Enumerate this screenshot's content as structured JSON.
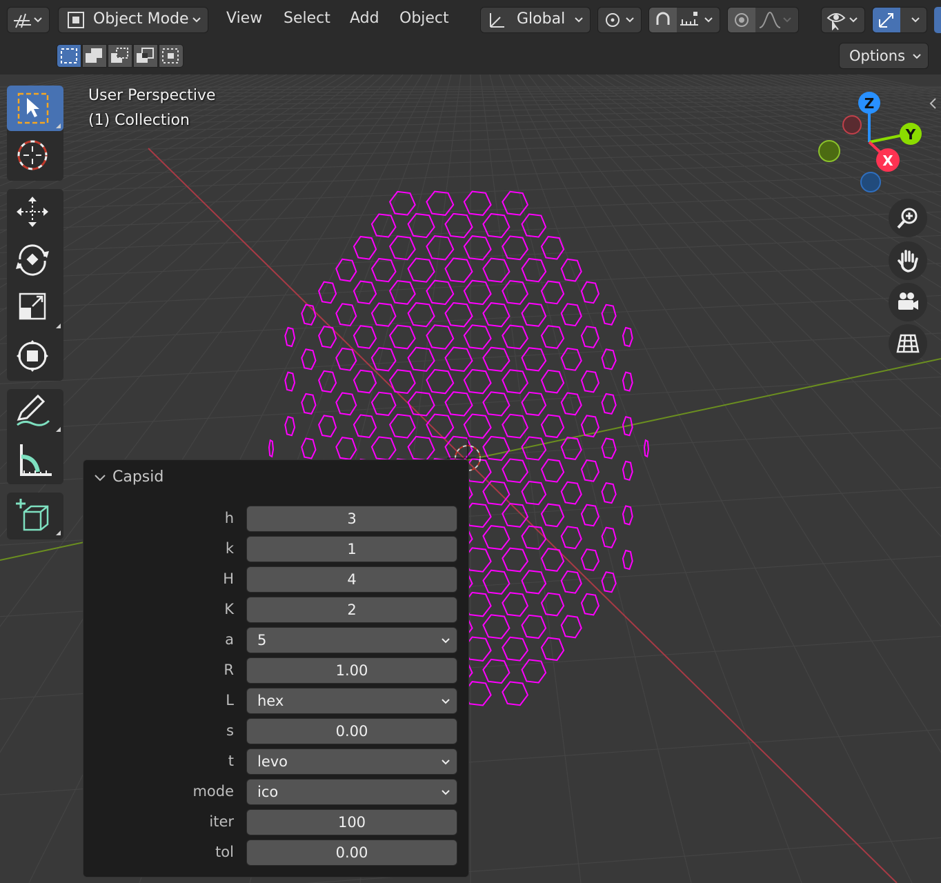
{
  "colors": {
    "accent": "#4772b3",
    "mesh": "#ff00ff",
    "axis_x": "#ff3352",
    "axis_y": "#8bdc00",
    "axis_z": "#2890ff"
  },
  "header": {
    "object_mode": "Object Mode",
    "menus": [
      "View",
      "Select",
      "Add",
      "Object"
    ],
    "orientation": "Global",
    "options_label": "Options"
  },
  "viewport": {
    "perspective_label": "User Perspective",
    "collection_label": "(1) Collection"
  },
  "gizmo": {
    "z": "Z",
    "y": "Y",
    "x": "X"
  },
  "toolbar": {
    "tools": [
      "select-box",
      "cursor",
      "move",
      "rotate",
      "scale",
      "transform",
      "annotate",
      "measure",
      "add-cube"
    ],
    "active": "select-box"
  },
  "nav_buttons": [
    "zoom-icon",
    "hand-pan-icon",
    "camera-icon",
    "grid-icon"
  ],
  "panel": {
    "title": "Capsid",
    "fields": [
      {
        "label": "h",
        "value": "3",
        "kind": "num"
      },
      {
        "label": "k",
        "value": "1",
        "kind": "num"
      },
      {
        "label": "H",
        "value": "4",
        "kind": "num"
      },
      {
        "label": "K",
        "value": "2",
        "kind": "num"
      },
      {
        "label": "a",
        "value": "5",
        "kind": "select"
      },
      {
        "label": "R",
        "value": "1.00",
        "kind": "num"
      },
      {
        "label": "L",
        "value": "hex",
        "kind": "select"
      },
      {
        "label": "s",
        "value": "0.00",
        "kind": "num"
      },
      {
        "label": "t",
        "value": "levo",
        "kind": "select"
      },
      {
        "label": "mode",
        "value": "ico",
        "kind": "select"
      },
      {
        "label": "iter",
        "value": "100",
        "kind": "num"
      },
      {
        "label": "tol",
        "value": "0.00",
        "kind": "num"
      }
    ]
  }
}
